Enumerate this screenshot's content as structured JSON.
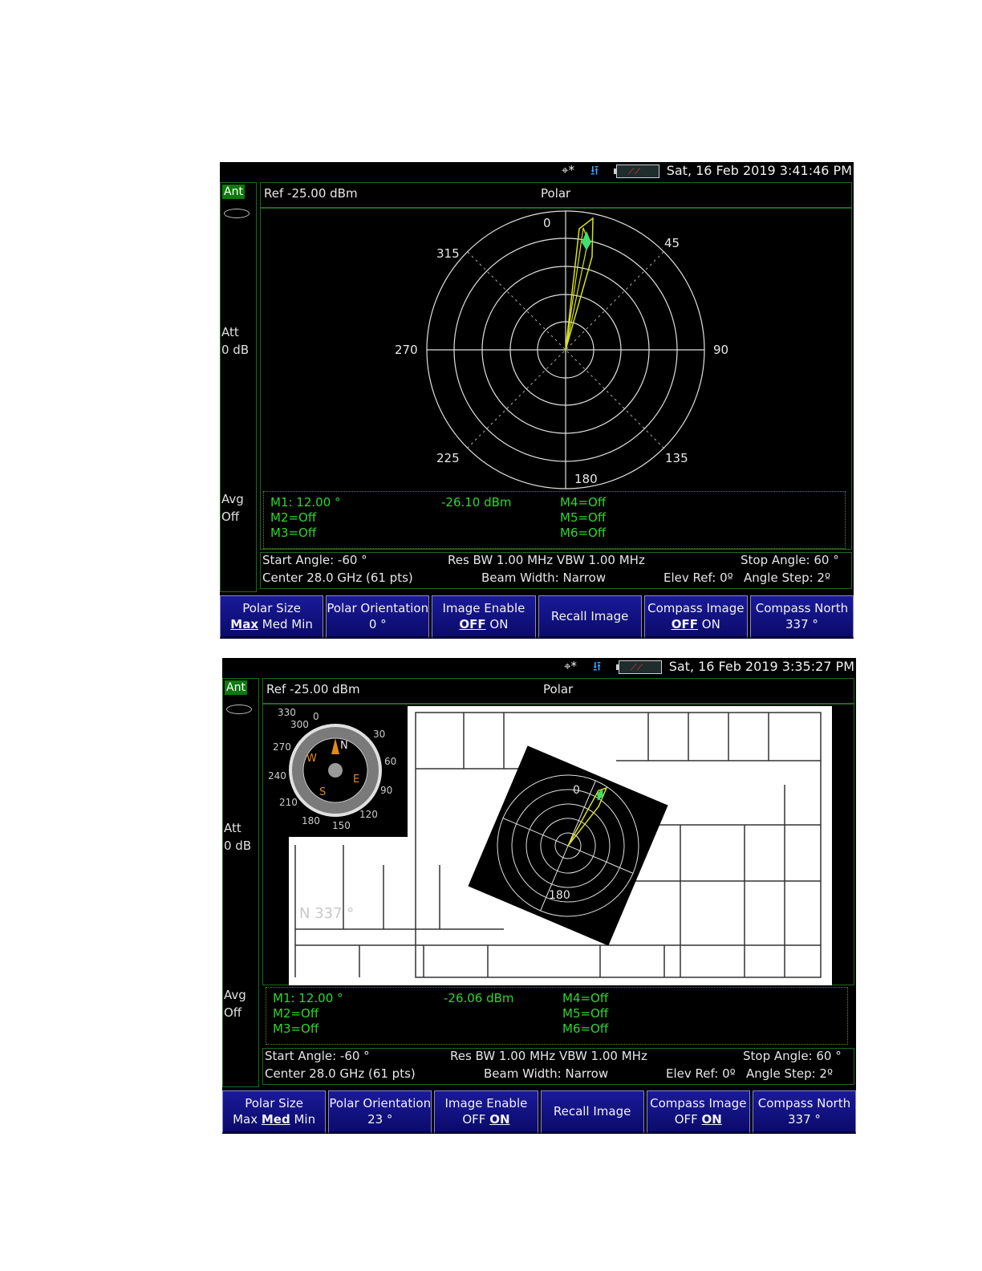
{
  "screens": [
    {
      "status": {
        "datetime": "Sat, 16 Feb 2019 3:41:46 PM",
        "gps_icon": "⌖*",
        "usb_icon": "usb-icon",
        "battery_icon": "battery-icon"
      },
      "left": {
        "tab": "Ant",
        "att_label": "Att",
        "att_value": "0 dB",
        "avg_label": "Avg",
        "avg_value": "Off"
      },
      "header": {
        "ref": "Ref -25.00 dBm",
        "title": "Polar"
      },
      "polar_labels": {
        "a0": "0",
        "a45": "45",
        "a90": "90",
        "a135": "135",
        "a180": "180",
        "a225": "225",
        "a270": "270",
        "a315": "315"
      },
      "markers": {
        "m1": "M1:  12.00 °",
        "m1_val": "-26.10 dBm",
        "m2": "M2=Off",
        "m3": "M3=Off",
        "m4": "M4=Off",
        "m5": "M5=Off",
        "m6": "M6=Off"
      },
      "meas": {
        "start": "Start Angle: -60 °",
        "resbw": "Res BW 1.00 MHz  VBW 1.00 MHz",
        "stop": "Stop Angle: 60 °",
        "center": "Center 28.0 GHz  (61 pts)",
        "beam": "Beam Width: Narrow",
        "elev": "Elev Ref: 0º",
        "step": "Angle Step:  2º"
      },
      "softkeys": {
        "polar_size": {
          "title": "Polar Size",
          "opt1": "Max",
          "opt2": "Med",
          "opt3": "Min"
        },
        "polar_orient": {
          "title": "Polar Orientation",
          "value": "0 °"
        },
        "image_enable": {
          "title": "Image Enable",
          "off": "OFF",
          "on": "ON"
        },
        "recall": {
          "title": "Recall Image"
        },
        "compass_image": {
          "title": "Compass Image",
          "off": "OFF",
          "on": "ON"
        },
        "compass_north": {
          "title": "Compass North",
          "value": "337 °"
        }
      }
    },
    {
      "status": {
        "datetime": "Sat, 16 Feb 2019 3:35:27 PM",
        "gps_icon": "⌖*",
        "usb_icon": "usb-icon",
        "battery_icon": "battery-icon"
      },
      "left": {
        "tab": "Ant",
        "att_label": "Att",
        "att_value": "0 dB",
        "avg_label": "Avg",
        "avg_value": "Off"
      },
      "header": {
        "ref": "Ref -25.00 dBm",
        "title": "Polar"
      },
      "compass": {
        "c330": "330",
        "c0": "0",
        "c30": "30",
        "c60": "60",
        "c90": "90",
        "c120": "120",
        "c150": "150",
        "c180": "180",
        "c210": "210",
        "c240": "240",
        "c270": "270",
        "c300": "300",
        "N": "N",
        "E": "E",
        "S": "S",
        "W": "W"
      },
      "polar_labels": {
        "a0": "0",
        "a180": "180"
      },
      "floor_label": "N 337 °",
      "markers": {
        "m1": "M1:  12.00 °",
        "m1_val": "-26.06 dBm",
        "m2": "M2=Off",
        "m3": "M3=Off",
        "m4": "M4=Off",
        "m5": "M5=Off",
        "m6": "M6=Off"
      },
      "meas": {
        "start": "Start Angle: -60 °",
        "resbw": "Res BW 1.00 MHz  VBW 1.00 MHz",
        "stop": "Stop Angle: 60 °",
        "center": "Center 28.0 GHz  (61 pts)",
        "beam": "Beam Width: Narrow",
        "elev": "Elev Ref: 0º",
        "step": "Angle Step:  2º"
      },
      "softkeys": {
        "polar_size": {
          "title": "Polar Size",
          "opt1": "Max",
          "opt2": "Med",
          "opt3": "Min"
        },
        "polar_orient": {
          "title": "Polar Orientation",
          "value": "23 °"
        },
        "image_enable": {
          "title": "Image Enable",
          "off": "OFF",
          "on": "ON"
        },
        "recall": {
          "title": "Recall Image"
        },
        "compass_image": {
          "title": "Compass Image",
          "off": "OFF",
          "on": "ON"
        },
        "compass_north": {
          "title": "Compass North",
          "value": "337 °"
        }
      }
    }
  ],
  "colors": {
    "trace": "#d8e020",
    "marker": "#40e070",
    "grid": "#e0e0e0",
    "accent_green": "#2ed62e",
    "softkey_blue": "#12128a"
  }
}
